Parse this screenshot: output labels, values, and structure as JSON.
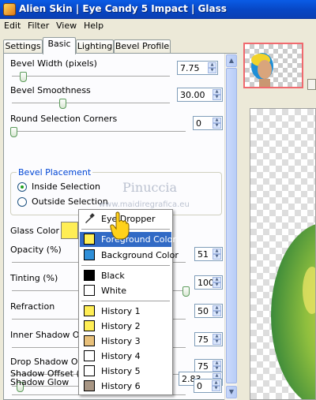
{
  "window": {
    "title": "Alien Skin | Eye Candy 5 Impact | Glass"
  },
  "menu": {
    "items": [
      "Edit",
      "Filter",
      "View",
      "Help"
    ]
  },
  "tabs": [
    "Settings",
    "Basic",
    "Lighting",
    "Bevel Profile"
  ],
  "active_tab": "Basic",
  "controls": {
    "bevel_width": {
      "label": "Bevel Width (pixels)",
      "value": "7.75",
      "fraction": 0.06
    },
    "bevel_smoothness": {
      "label": "Bevel Smoothness",
      "value": "30.00",
      "fraction": 0.3
    },
    "round_corners": {
      "label": "Round Selection Corners",
      "value": "0",
      "fraction": 0.0
    },
    "bevel_placement": {
      "legend": "Bevel Placement",
      "inside": "Inside Selection",
      "outside": "Outside Selection",
      "selected": "inside"
    },
    "glass_color": {
      "label": "Glass Color",
      "color": "#ffee55"
    },
    "opacity": {
      "label": "Opacity (%)",
      "value": "51",
      "fraction": 0.51
    },
    "tinting": {
      "label": "Tinting (%)",
      "value": "100",
      "fraction": 1.0
    },
    "refraction": {
      "label": "Refraction",
      "value": "50",
      "fraction": 0.5
    },
    "inner_shadow": {
      "label": "Inner Shadow Opa",
      "value": "75",
      "fraction": 0.75
    },
    "drop_shadow": {
      "label": "Drop Shadow Opa",
      "value": "75",
      "fraction": 0.75
    },
    "shadow_offset": {
      "label": "Shadow Offset (pi",
      "value": "2.83",
      "fraction": 0.03
    },
    "shadow_glow": {
      "label": "Shadow Glow",
      "value": "0",
      "fraction": 0.0
    }
  },
  "watermark": {
    "title": "Pinuccia",
    "url": "www.maidiregrafica.eu"
  },
  "color_menu": {
    "eyedropper": "Eye Dropper",
    "foreground": {
      "label": "Foreground Color",
      "color": "#ffee55"
    },
    "background": {
      "label": "Background Color",
      "color": "#2f8fd8"
    },
    "black": {
      "label": "Black",
      "color": "#000000"
    },
    "white": {
      "label": "White",
      "color": "#ffffff"
    },
    "history": [
      {
        "label": "History 1",
        "color": "#ffee55"
      },
      {
        "label": "History 2",
        "color": "#ffee55"
      },
      {
        "label": "History 3",
        "color": "#e8c07a"
      },
      {
        "label": "History 4",
        "color": "#ffffff"
      },
      {
        "label": "History 5",
        "color": "#ffffff"
      },
      {
        "label": "History 6",
        "color": "#a89684"
      }
    ],
    "selected": "Foreground Color"
  },
  "colors": {
    "accent": "#316ac5",
    "titlebar": "#0a5ce6",
    "group_legend": "#0046d5"
  }
}
